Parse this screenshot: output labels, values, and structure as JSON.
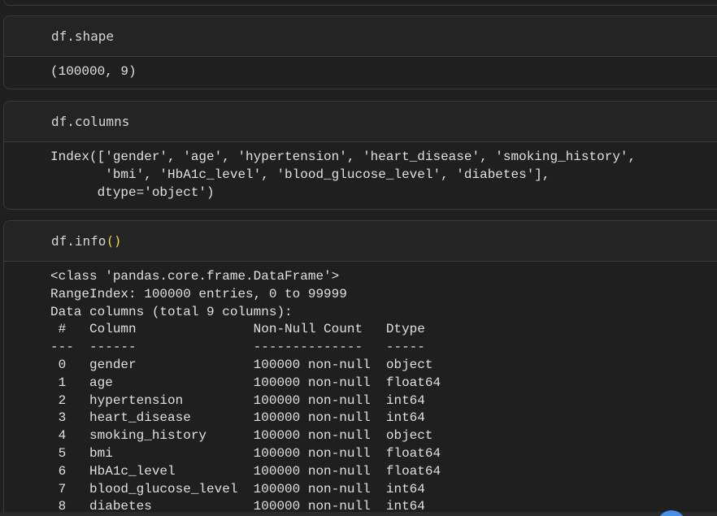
{
  "cells": [
    {
      "code": "df.shape",
      "output": "(100000, 9)"
    },
    {
      "code": "df.columns",
      "output": "Index(['gender', 'age', 'hypertension', 'heart_disease', 'smoking_history',\n       'bmi', 'HbA1c_level', 'blood_glucose_level', 'diabetes'],\n      dtype='object')"
    },
    {
      "code_name": "df.info",
      "code_parens": "()",
      "output": "<class 'pandas.core.frame.DataFrame'>\nRangeIndex: 100000 entries, 0 to 99999\nData columns (total 9 columns):\n #   Column               Non-Null Count   Dtype  \n---  ------               --------------   -----  \n 0   gender               100000 non-null  object \n 1   age                  100000 non-null  float64\n 2   hypertension         100000 non-null  int64  \n 3   heart_disease        100000 non-null  int64  \n 4   smoking_history      100000 non-null  object \n 5   bmi                  100000 non-null  float64\n 6   HbA1c_level          100000 non-null  float64\n 7   blood_glucose_level  100000 non-null  int64  \n 8   diabetes             100000 non-null  int64  "
    }
  ]
}
